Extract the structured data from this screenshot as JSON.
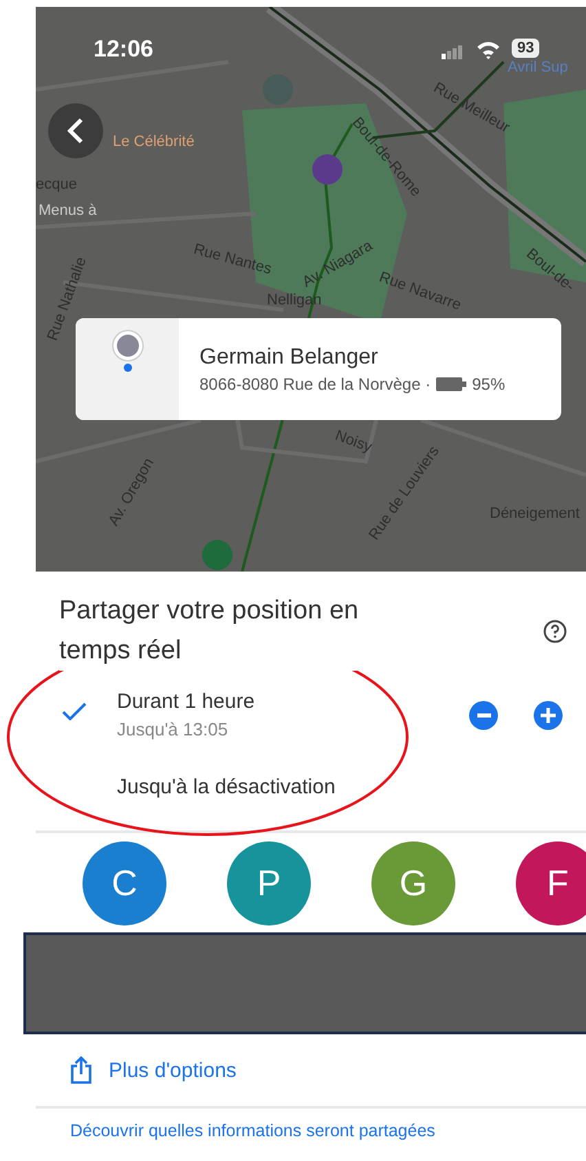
{
  "status_bar": {
    "time": "12:06",
    "battery": "93"
  },
  "map": {
    "labels": [
      {
        "text": "Rue Meilleur"
      },
      {
        "text": "Avril Sup"
      },
      {
        "text": "Le Célébrité"
      },
      {
        "text": "ecque"
      },
      {
        "text": "Menus à"
      },
      {
        "text": "Boul-de-Rome"
      },
      {
        "text": "Boul-de-"
      },
      {
        "text": "Rue Nathalie"
      },
      {
        "text": "Rue Nantes"
      },
      {
        "text": "Av. Niagara"
      },
      {
        "text": "Rue Navarre"
      },
      {
        "text": "Nelligan"
      },
      {
        "text": "Noisy"
      },
      {
        "text": "Av. Oregon"
      },
      {
        "text": "Rue de Louviers"
      },
      {
        "text": "Déneigement"
      }
    ]
  },
  "person_card": {
    "name": "Germain Belanger",
    "address": "8066-8080 Rue de la Norvège ·",
    "battery": "95%"
  },
  "sheet": {
    "title": "Partager votre position en temps réel",
    "options": [
      {
        "label": "Durant 1 heure",
        "detail": "Jusqu'à 13:05",
        "selected": true
      },
      {
        "label": "Jusqu'à la désactivation",
        "selected": false
      }
    ],
    "contacts": [
      {
        "initial": "C",
        "color": "#1a7fcf"
      },
      {
        "initial": "P",
        "color": "#16939b"
      },
      {
        "initial": "G",
        "color": "#6a9a37"
      },
      {
        "initial": "F",
        "color": "#c2185b"
      }
    ],
    "more_options": "Plus d'options",
    "info_link": "Découvrir quelles informations seront partagées"
  }
}
